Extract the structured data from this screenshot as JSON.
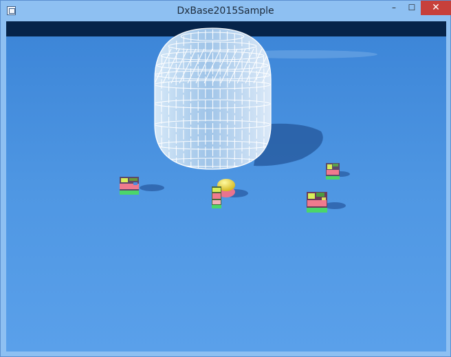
{
  "window": {
    "title": "DxBase2015Sample",
    "controls": {
      "minimize": "–",
      "maximize": "☐",
      "close": "✕"
    }
  },
  "scene": {
    "sky_color": "#07254b",
    "ground_color": "#5a9ee6",
    "objects": [
      {
        "kind": "wireframe-dome",
        "color": "#ffffff"
      },
      {
        "kind": "player-sphere",
        "color": "#f0e060"
      },
      {
        "kind": "textured-cube",
        "count": 4
      }
    ]
  }
}
